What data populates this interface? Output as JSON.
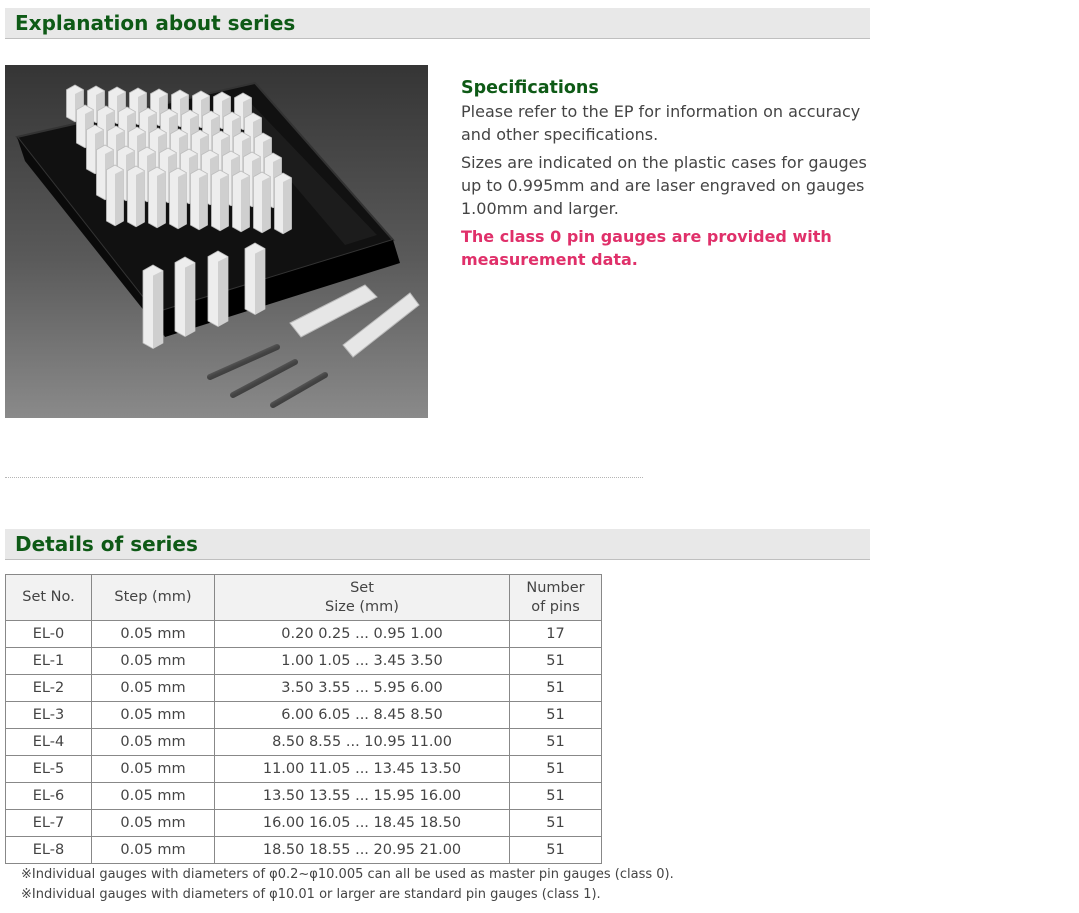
{
  "sections": {
    "explanation_title": "Explanation about series",
    "details_title": "Details of series"
  },
  "specs": {
    "heading": "Specifications",
    "para1": "Please refer to the EP for information on accuracy and other specifications.",
    "para2": "Sizes are indicated on the plastic cases for gauges up to 0.995mm and are laser engraved on gauges 1.00mm and larger.",
    "highlight": "The class 0 pin gauges are provided with measurement data."
  },
  "table": {
    "headers": {
      "set_no": "Set No.",
      "step": "Step (mm)",
      "set_line1": "Set",
      "set_line2": "Size (mm)",
      "num_line1": "Number",
      "num_line2": "of pins"
    },
    "rows": [
      {
        "set": "EL-0",
        "step": "0.05 mm",
        "size": "0.20 0.25 ... 0.95 1.00",
        "pins": "17"
      },
      {
        "set": "EL-1",
        "step": "0.05 mm",
        "size": "1.00 1.05 ... 3.45 3.50",
        "pins": "51"
      },
      {
        "set": "EL-2",
        "step": "0.05 mm",
        "size": "3.50 3.55 ... 5.95 6.00",
        "pins": "51"
      },
      {
        "set": "EL-3",
        "step": "0.05 mm",
        "size": "6.00 6.05 ... 8.45 8.50",
        "pins": "51"
      },
      {
        "set": "EL-4",
        "step": "0.05 mm",
        "size": "8.50 8.55 ... 10.95 11.00",
        "pins": "51"
      },
      {
        "set": "EL-5",
        "step": "0.05 mm",
        "size": "11.00 11.05 ... 13.45 13.50",
        "pins": "51"
      },
      {
        "set": "EL-6",
        "step": "0.05 mm",
        "size": "13.50 13.55 ... 15.95 16.00",
        "pins": "51"
      },
      {
        "set": "EL-7",
        "step": "0.05 mm",
        "size": "16.00 16.05 ... 18.45 18.50",
        "pins": "51"
      },
      {
        "set": "EL-8",
        "step": "0.05 mm",
        "size": "18.50 18.55 ... 20.95 21.00",
        "pins": "51"
      }
    ]
  },
  "footnotes": [
    "※Individual gauges with diameters of φ0.2~φ10.005 can all be used as master pin gauges (class 0).",
    "※Individual gauges with diameters of φ10.01 or larger are standard pin gauges (class 1)."
  ],
  "colors": {
    "heading_green": "#0e5a16",
    "highlight_pink": "#e0306a",
    "header_bg": "#e8e8e8"
  }
}
